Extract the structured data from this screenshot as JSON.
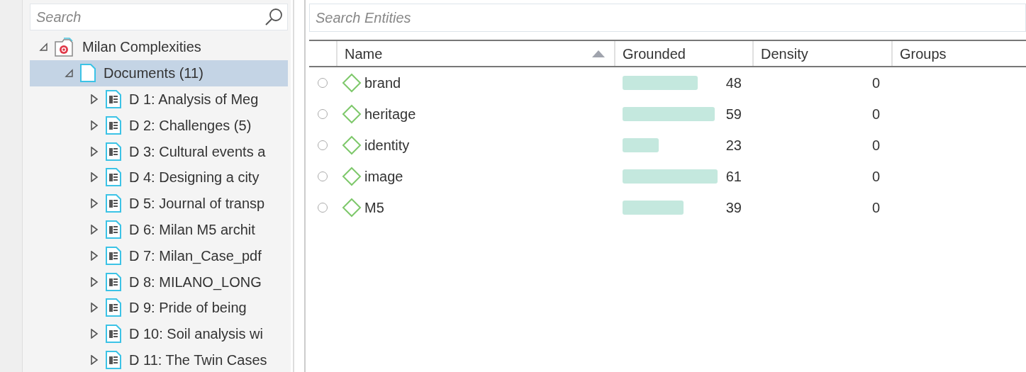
{
  "sidebar": {
    "search": {
      "placeholder": "Search"
    },
    "tree": [
      {
        "label": "Milan Complexities",
        "kind": "project",
        "expanded": true,
        "selected": false,
        "children": [
          {
            "label": "Documents (11)",
            "kind": "folder",
            "expanded": true,
            "selected": true,
            "children": [
              {
                "label": "D 1: Analysis of Meg",
                "kind": "document",
                "expanded": false,
                "selected": false
              },
              {
                "label": "D 2: Challenges (5)",
                "kind": "document",
                "expanded": false,
                "selected": false
              },
              {
                "label": "D 3: Cultural events a",
                "kind": "document",
                "expanded": false,
                "selected": false
              },
              {
                "label": "D 4: Designing a city",
                "kind": "document",
                "expanded": false,
                "selected": false
              },
              {
                "label": "D 5: Journal of transp",
                "kind": "document",
                "expanded": false,
                "selected": false
              },
              {
                "label": "D 6: Milan M5 archit",
                "kind": "document",
                "expanded": false,
                "selected": false
              },
              {
                "label": "D 7: Milan_Case_pdf",
                "kind": "document",
                "expanded": false,
                "selected": false
              },
              {
                "label": "D 8: MILANO_LONG",
                "kind": "document",
                "expanded": false,
                "selected": false
              },
              {
                "label": "D 9: Pride of being",
                "kind": "document",
                "expanded": false,
                "selected": false
              },
              {
                "label": "D 10: Soil analysis wi",
                "kind": "document",
                "expanded": false,
                "selected": false
              },
              {
                "label": "D 11: The Twin Cases",
                "kind": "document",
                "expanded": false,
                "selected": false
              }
            ]
          }
        ]
      }
    ]
  },
  "entities": {
    "search": {
      "placeholder": "Search Entities"
    },
    "table": {
      "columns": [
        {
          "label": "Name",
          "sorted": true
        },
        {
          "label": "Grounded"
        },
        {
          "label": "Density"
        },
        {
          "label": "Groups"
        }
      ],
      "rows": [
        {
          "selected": false,
          "name": "brand",
          "grounded": "48",
          "density": "0"
        },
        {
          "selected": false,
          "name": "heritage",
          "grounded": "59",
          "density": "0"
        },
        {
          "selected": false,
          "name": "identity",
          "grounded": "23",
          "density": "0"
        },
        {
          "selected": false,
          "name": "image",
          "grounded": "61",
          "density": "0"
        },
        {
          "selected": false,
          "name": "M5",
          "grounded": "39",
          "density": "0"
        }
      ]
    }
  }
}
